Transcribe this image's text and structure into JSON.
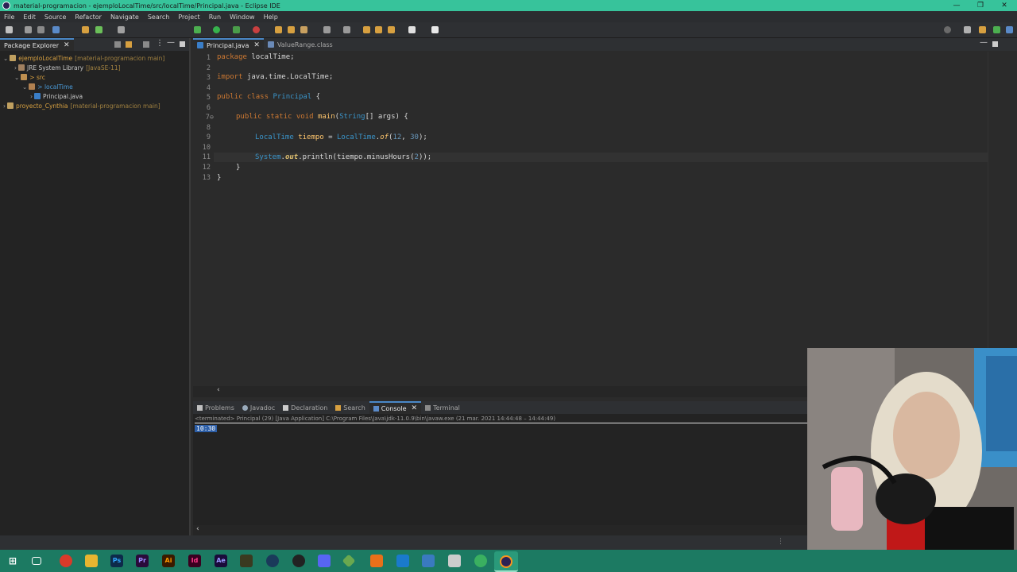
{
  "window": {
    "title": "material-programacion - ejemploLocalTime/src/localTime/Principal.java - Eclipse IDE",
    "controls": [
      "—",
      "❐",
      "✕"
    ]
  },
  "menu": [
    "File",
    "Edit",
    "Source",
    "Refactor",
    "Navigate",
    "Search",
    "Project",
    "Run",
    "Window",
    "Help"
  ],
  "package_explorer": {
    "tab_label": "Package Explorer",
    "tree": [
      {
        "label": "ejemploLocalTime",
        "decor": "[material-programacion main]"
      },
      {
        "label": "JRE System Library",
        "decor": "[JavaSE-11]"
      },
      {
        "label": "> src",
        "decor": ""
      },
      {
        "label": "> localTime",
        "decor": ""
      },
      {
        "label": "Principal.java",
        "decor": ""
      },
      {
        "label": "proyecto_Cynthia",
        "decor": "[material-programacion main]"
      }
    ]
  },
  "editor": {
    "tabs": [
      "Principal.java",
      "ValueRange.class"
    ],
    "line_numbers": [
      "1",
      "2",
      "3",
      "4",
      "5",
      "6",
      "7⊖",
      "8",
      "9",
      "10",
      "11",
      "12",
      "13"
    ],
    "code": {
      "l1_kw": "package",
      "l1_rest": " localTime;",
      "l3_kw": "import",
      "l3_rest": " java.time.LocalTime;",
      "l5_kw": "public class",
      "l5_cls": " Principal",
      "l5_rest": " {",
      "l7_kw": "public static void",
      "l7_fn": " main",
      "l7_p": "(",
      "l7_typ": "String",
      "l7_rest": "[] args) {",
      "l9_typ": "LocalTime",
      "l9_var": " tiempo",
      "l9_eq": " = ",
      "l9_typ2": "LocalTime",
      "l9_dot": ".",
      "l9_fn": "of",
      "l9_open": "(",
      "l9_n1": "12",
      "l9_comma": ", ",
      "l9_n2": "30",
      "l9_close": ");",
      "l11_typ": "System",
      "l11_dot": ".",
      "l11_fld": "out",
      "l11_rest": ".println(tiempo.minusHours(",
      "l11_num": "2",
      "l11_end": "));",
      "l12": "}",
      "l13": "}"
    }
  },
  "console": {
    "tabs": [
      "Problems",
      "Javadoc",
      "Declaration",
      "Search",
      "Console",
      "Terminal"
    ],
    "header": "<terminated> Principal (29) [Java Application] C:\\Program Files\\Java\\jdk-11.0.9\\bin\\javaw.exe  (21 mar. 2021 14:44:48 – 14:44:49)",
    "output": "10:30"
  },
  "colors": {
    "accent": "#37c39b",
    "taskbar": "#1c7a62",
    "editor_bg": "#2b2b2b"
  },
  "taskbar_icons": [
    "windows-start-icon",
    "task-view-icon",
    "chrome-icon",
    "file-explorer-icon",
    "photoshop-icon",
    "premiere-icon",
    "illustrator-icon",
    "indesign-icon",
    "after-effects-icon",
    "eclipse-icon"
  ]
}
